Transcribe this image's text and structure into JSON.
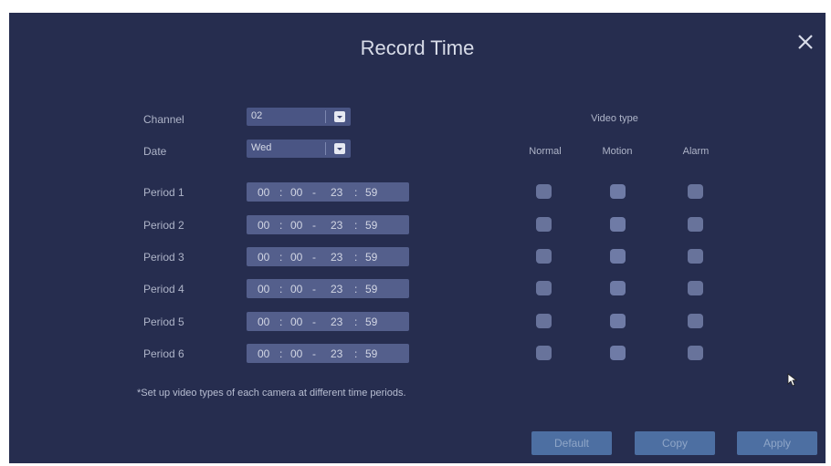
{
  "dialog": {
    "title": "Record Time"
  },
  "form": {
    "channel_label": "Channel",
    "channel_value": "02",
    "date_label": "Date",
    "date_value": "Wed"
  },
  "periods": [
    {
      "label": "Period 1",
      "start_h": "00",
      "start_m": "00",
      "end_h": "23",
      "end_m": "59"
    },
    {
      "label": "Period 2",
      "start_h": "00",
      "start_m": "00",
      "end_h": "23",
      "end_m": "59"
    },
    {
      "label": "Period 3",
      "start_h": "00",
      "start_m": "00",
      "end_h": "23",
      "end_m": "59"
    },
    {
      "label": "Period 4",
      "start_h": "00",
      "start_m": "00",
      "end_h": "23",
      "end_m": "59"
    },
    {
      "label": "Period 5",
      "start_h": "00",
      "start_m": "00",
      "end_h": "23",
      "end_m": "59"
    },
    {
      "label": "Period 6",
      "start_h": "00",
      "start_m": "00",
      "end_h": "23",
      "end_m": "59"
    }
  ],
  "video_type": {
    "heading": "Video type",
    "columns": [
      "Normal",
      "Motion",
      "Alarm"
    ]
  },
  "note": "*Set up video types of each camera at different time periods.",
  "buttons": {
    "default": "Default",
    "copy": "Copy",
    "apply": "Apply"
  },
  "colors": {
    "background": "#262d4f",
    "input": "#545f8c",
    "button": "#4d6fa2"
  }
}
